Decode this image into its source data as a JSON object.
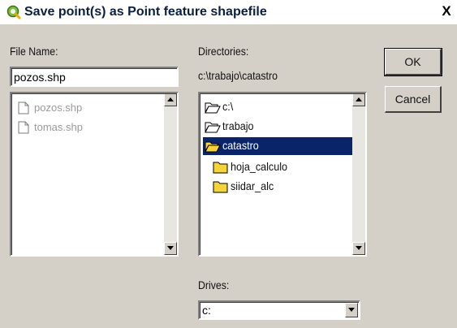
{
  "window": {
    "title": "Save point(s) as Point feature shapefile",
    "close_glyph": "X",
    "icon": "qgis-icon"
  },
  "file_name": {
    "label": "File Name:",
    "value": "pozos.shp"
  },
  "file_list": {
    "items": [
      "pozos.shp",
      "tomas.shp"
    ],
    "item_icon": "document-icon"
  },
  "directories": {
    "label": "Directories:",
    "current_path": "c:\\trabajo\\catastro",
    "items": [
      {
        "label": "c:\\",
        "icon": "open-folder-icon",
        "selected": false
      },
      {
        "label": "trabajo",
        "icon": "open-folder-icon",
        "selected": false
      },
      {
        "label": "catastro",
        "icon": "open-folder-icon",
        "selected": true
      },
      {
        "label": "hoja_calculo",
        "icon": "folder-icon",
        "selected": false
      },
      {
        "label": "siidar_alc",
        "icon": "folder-icon",
        "selected": false
      }
    ]
  },
  "buttons": {
    "ok": "OK",
    "cancel": "Cancel"
  },
  "drives": {
    "label": "Drives:",
    "selected": "c:"
  },
  "colors": {
    "dialog_bg": "#d4d0c8",
    "selection": "#0a246a",
    "folder_yellow": "#f5d43a"
  }
}
